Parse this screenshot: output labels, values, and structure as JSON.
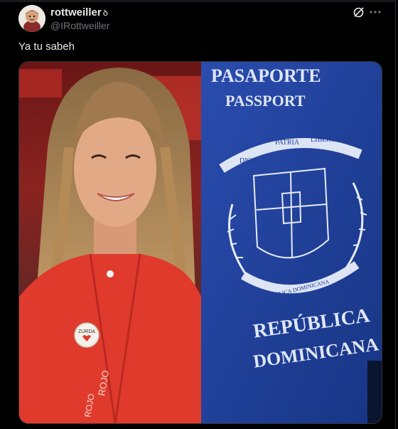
{
  "tweet": {
    "display_name": "rottweiller",
    "name_flair": "ꝺ",
    "handle": "@IRottweiller",
    "text": "Ya tu sabeh"
  },
  "media": {
    "pin_text": "ZURDA",
    "vest_text": "ROJO",
    "vest_text_lower": "ROJO",
    "passport_heading_1": "PASAPORTE",
    "passport_heading_2": "PASSPORT",
    "motto_left": "DIOS",
    "motto_center": "PATRIA",
    "motto_right": "LIBERTAD",
    "crest_ribbon": "REPÚBLICA DOMINICANA",
    "country_line_1": "REPÚBLICA",
    "country_line_2": "DOMINICANA"
  },
  "icons": {
    "grok": "grok-icon",
    "more": "more-icon"
  },
  "colors": {
    "background": "#000000",
    "text_primary": "#e7e9ea",
    "text_secondary": "#71767b",
    "passport_blue": "#1f3f9a",
    "vest_red": "#e03a2c"
  }
}
